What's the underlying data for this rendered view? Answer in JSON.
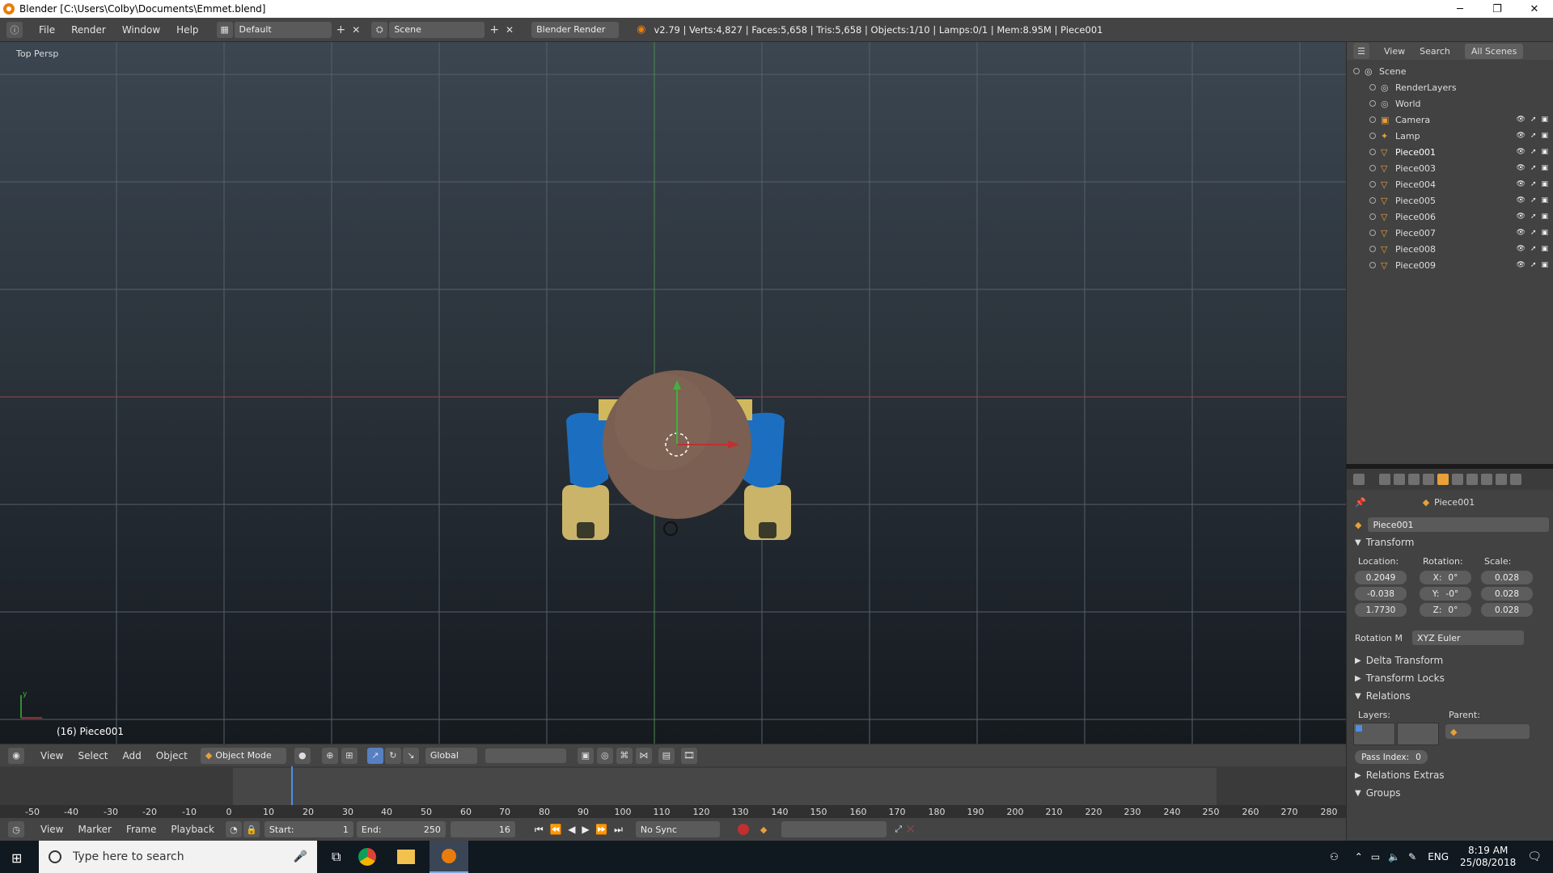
{
  "window": {
    "title": "Blender [C:\\Users\\Colby\\Documents\\Emmet.blend]",
    "controls": [
      "─",
      "❐",
      "✕"
    ]
  },
  "topbar": {
    "menus": [
      "File",
      "Render",
      "Window",
      "Help"
    ],
    "layout_name": "Default",
    "scene_name": "Scene",
    "engine": "Blender Render",
    "stats": "v2.79 | Verts:4,827 | Faces:5,658 | Tris:5,658 | Objects:1/10 | Lamps:0/1 | Mem:8.95M | Piece001"
  },
  "viewport": {
    "view_label": "Top Persp",
    "object_label": "(16) Piece001",
    "axis_y": "y"
  },
  "view3d_header": {
    "menus": [
      "View",
      "Select",
      "Add",
      "Object"
    ],
    "mode": "Object Mode",
    "orientation": "Global"
  },
  "timeline": {
    "ticks": [
      "-50",
      "-40",
      "-30",
      "-20",
      "-10",
      "0",
      "10",
      "20",
      "30",
      "40",
      "50",
      "60",
      "70",
      "80",
      "90",
      "100",
      "110",
      "120",
      "130",
      "140",
      "150",
      "160",
      "170",
      "180",
      "190",
      "200",
      "210",
      "220",
      "230",
      "240",
      "250",
      "260",
      "270",
      "280"
    ],
    "menus": [
      "View",
      "Marker",
      "Frame",
      "Playback"
    ],
    "start_label": "Start:",
    "start_value": "1",
    "end_label": "End:",
    "end_value": "250",
    "current_frame": "16",
    "sync": "No Sync"
  },
  "outliner": {
    "header": [
      "View",
      "Search",
      "All Scenes"
    ],
    "items": [
      {
        "name": "Scene",
        "level": 0,
        "icon": "scene-icon",
        "vis": false
      },
      {
        "name": "RenderLayers",
        "level": 1,
        "icon": "render-layers-icon",
        "vis": false
      },
      {
        "name": "World",
        "level": 1,
        "icon": "world-icon",
        "vis": false
      },
      {
        "name": "Camera",
        "level": 1,
        "icon": "camera-icon",
        "vis": true
      },
      {
        "name": "Lamp",
        "level": 1,
        "icon": "lamp-icon",
        "vis": true
      },
      {
        "name": "Piece001",
        "level": 1,
        "icon": "mesh-icon",
        "vis": true
      },
      {
        "name": "Piece003",
        "level": 1,
        "icon": "mesh-icon",
        "vis": true
      },
      {
        "name": "Piece004",
        "level": 1,
        "icon": "mesh-icon",
        "vis": true
      },
      {
        "name": "Piece005",
        "level": 1,
        "icon": "mesh-icon",
        "vis": true
      },
      {
        "name": "Piece006",
        "level": 1,
        "icon": "mesh-icon",
        "vis": true
      },
      {
        "name": "Piece007",
        "level": 1,
        "icon": "mesh-icon",
        "vis": true
      },
      {
        "name": "Piece008",
        "level": 1,
        "icon": "mesh-icon",
        "vis": true
      },
      {
        "name": "Piece009",
        "level": 1,
        "icon": "mesh-icon",
        "vis": true
      }
    ]
  },
  "properties": {
    "context_name": "Piece001",
    "object_name": "Piece001",
    "transform_title": "Transform",
    "location_label": "Location:",
    "rotation_label": "Rotation:",
    "scale_label": "Scale:",
    "location": [
      "0.2049",
      "-0.038",
      "1.7730"
    ],
    "rotation": [
      [
        "X:",
        "0°"
      ],
      [
        "Y:",
        "-0°"
      ],
      [
        "Z:",
        "0°"
      ]
    ],
    "scale": [
      "0.028",
      "0.028",
      "0.028"
    ],
    "rotation_mode_label": "Rotation M",
    "rotation_mode": "XYZ Euler",
    "delta_transform": "Delta Transform",
    "transform_locks": "Transform Locks",
    "relations": "Relations",
    "layers_label": "Layers:",
    "parent_label": "Parent:",
    "pass_index_label": "Pass Index:",
    "pass_index": "0",
    "relations_extras": "Relations Extras",
    "groups": "Groups"
  },
  "taskbar": {
    "search_placeholder": "Type here to search",
    "lang": "ENG",
    "time": "8:19 AM",
    "date": "25/08/2018"
  },
  "colors": {
    "accent": "#e87d0d",
    "selected_blue": "#4d8ee6",
    "panel_bg": "#424242"
  }
}
